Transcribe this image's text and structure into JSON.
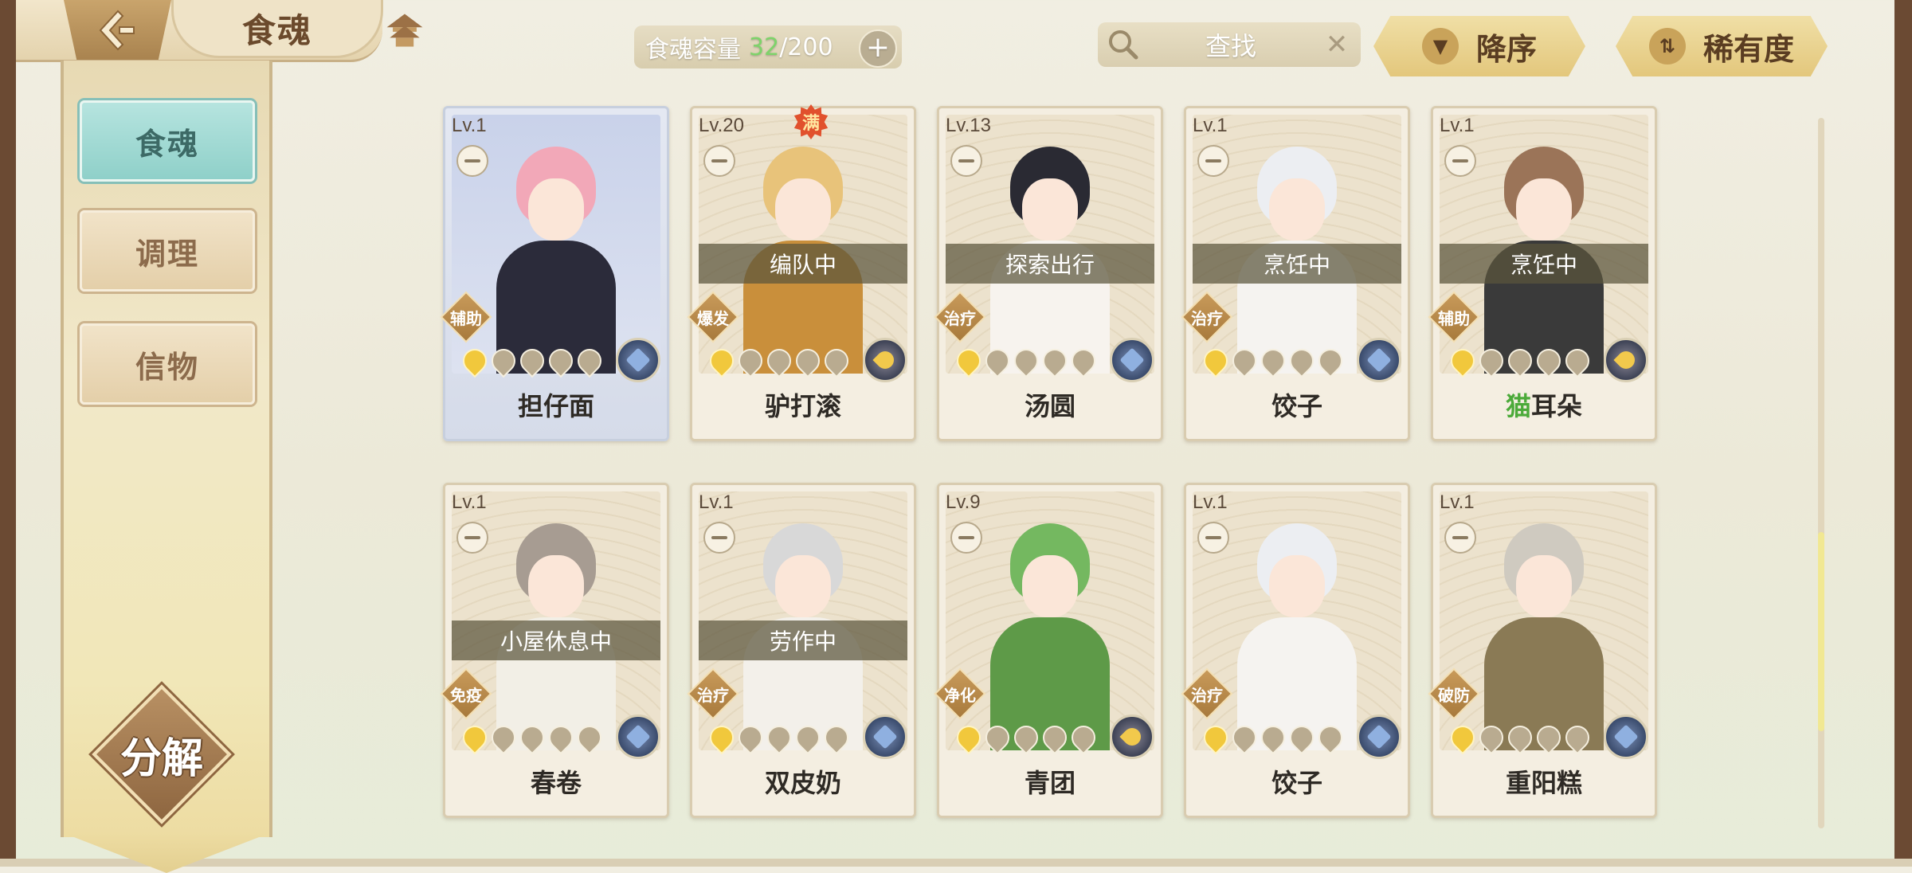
{
  "header": {
    "title": "食魂",
    "capacity_label": "食魂容量",
    "capacity_current": "32",
    "capacity_separator": "/",
    "capacity_max": "200",
    "capacity_add": "+",
    "search_label": "查找",
    "search_clear": "✕",
    "sort_order_label": "降序",
    "sort_key_label": "稀有度"
  },
  "sidebar": {
    "tabs": [
      {
        "label": "食魂",
        "active": true
      },
      {
        "label": "调理",
        "active": false
      },
      {
        "label": "信物",
        "active": false
      }
    ],
    "decompose_label": "分解"
  },
  "cards": [
    {
      "level": "Lv.1",
      "name": "担仔面",
      "role": "辅助",
      "status": "",
      "max_badge": "",
      "element": "blue",
      "selected": true,
      "stars_lit": 1,
      "hair": "#f2a8b8",
      "outfit": "#2b2b3a"
    },
    {
      "level": "Lv.20",
      "name": "驴打滚",
      "role": "爆发",
      "status": "编队中",
      "max_badge": "满",
      "element": "gold",
      "selected": false,
      "stars_lit": 1,
      "hair": "#e8c37a",
      "outfit": "#c98f3b"
    },
    {
      "level": "Lv.13",
      "name": "汤圆",
      "role": "治疗",
      "status": "探索出行",
      "max_badge": "",
      "element": "blue",
      "selected": false,
      "stars_lit": 1,
      "hair": "#2a2a33",
      "outfit": "#f7f3ee"
    },
    {
      "level": "Lv.1",
      "name": "饺子",
      "role": "治疗",
      "status": "烹饪中",
      "max_badge": "",
      "element": "blue",
      "selected": false,
      "stars_lit": 1,
      "hair": "#eceef2",
      "outfit": "#f5f3f0"
    },
    {
      "level": "Lv.1",
      "name_hl": "猫",
      "name_rest": "耳朵",
      "name": "猫耳朵",
      "role": "辅助",
      "status": "烹饪中",
      "max_badge": "",
      "element": "gold",
      "selected": false,
      "stars_lit": 1,
      "hair": "#9b7458",
      "outfit": "#3a3a3a"
    },
    {
      "level": "Lv.1",
      "name": "春卷",
      "role": "免疫",
      "status": "小屋休息中",
      "max_badge": "",
      "element": "blue",
      "selected": false,
      "stars_lit": 1,
      "hair": "#a79c92",
      "outfit": "#f2efe6"
    },
    {
      "level": "Lv.1",
      "name": "双皮奶",
      "role": "治疗",
      "status": "劳作中",
      "max_badge": "",
      "element": "blue",
      "selected": false,
      "stars_lit": 1,
      "hair": "#d8d8d8",
      "outfit": "#f3f0ea"
    },
    {
      "level": "Lv.9",
      "name": "青团",
      "role": "净化",
      "status": "",
      "max_badge": "",
      "element": "gold",
      "selected": false,
      "stars_lit": 1,
      "hair": "#74b860",
      "outfit": "#5e9a48"
    },
    {
      "level": "Lv.1",
      "name": "饺子",
      "role": "治疗",
      "status": "",
      "max_badge": "",
      "element": "blue",
      "selected": false,
      "stars_lit": 1,
      "hair": "#eceef2",
      "outfit": "#f5f3f0"
    },
    {
      "level": "Lv.1",
      "name": "重阳糕",
      "role": "破防",
      "status": "",
      "max_badge": "",
      "element": "blue",
      "selected": false,
      "stars_lit": 1,
      "hair": "#cfcac0",
      "outfit": "#8a7a55"
    }
  ],
  "colors": {
    "accent_teal": "#8fd0c9",
    "capacity_count": "#7ed36a",
    "sort_gold": "#e3c77c",
    "highlight_green": "#4caa3a"
  }
}
